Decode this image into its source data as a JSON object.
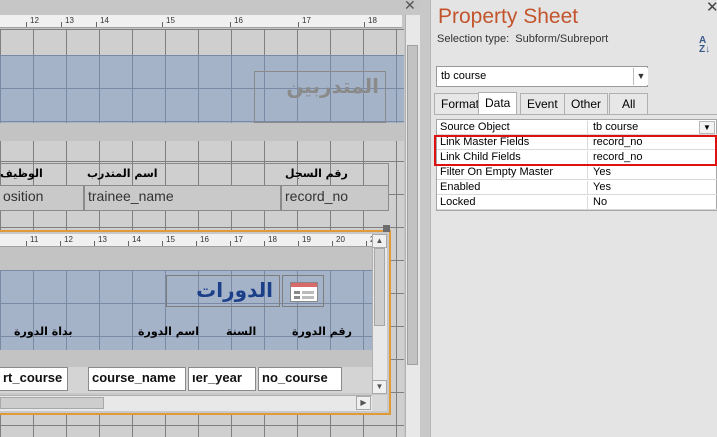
{
  "design": {
    "ruler_top": [
      "12",
      "13",
      "14",
      "15",
      "16",
      "17",
      "18"
    ],
    "main_title": "المتدربين",
    "labels": {
      "record_no": "رقم السجل",
      "trainee_name": "اسم المتدرب",
      "position": "الوظيف"
    },
    "fields": {
      "record_no": "record_no",
      "trainee_name": "trainee_name",
      "position": "osition"
    },
    "subform": {
      "ruler": [
        "11",
        "12",
        "13",
        "14",
        "15",
        "16",
        "17",
        "18",
        "19",
        "20",
        "2"
      ],
      "title": "الدورات",
      "labels": {
        "no_course": "رقم الدورة",
        "year": "السنة",
        "course_name": "اسم الدورة",
        "start_course": "بداة الدورة"
      },
      "fields": {
        "start_course": "rt_course",
        "course_name": "course_name",
        "year": "ıer_year",
        "no_course": "no_course"
      }
    }
  },
  "property_sheet": {
    "title": "Property Sheet",
    "selection_type_label": "Selection type:",
    "selection_type_value": "Subform/Subreport",
    "object_combo": "tb course",
    "tabs": [
      "Format",
      "Data",
      "Event",
      "Other",
      "All"
    ],
    "active_tab": "Data",
    "properties": [
      {
        "name": "Source Object",
        "value": "tb course"
      },
      {
        "name": "Link Master Fields",
        "value": "record_no"
      },
      {
        "name": "Link Child Fields",
        "value": "record_no"
      },
      {
        "name": "Filter On Empty Master",
        "value": "Yes"
      },
      {
        "name": "Enabled",
        "value": "Yes"
      },
      {
        "name": "Locked",
        "value": "No"
      }
    ],
    "highlight_color": "#e01010"
  }
}
